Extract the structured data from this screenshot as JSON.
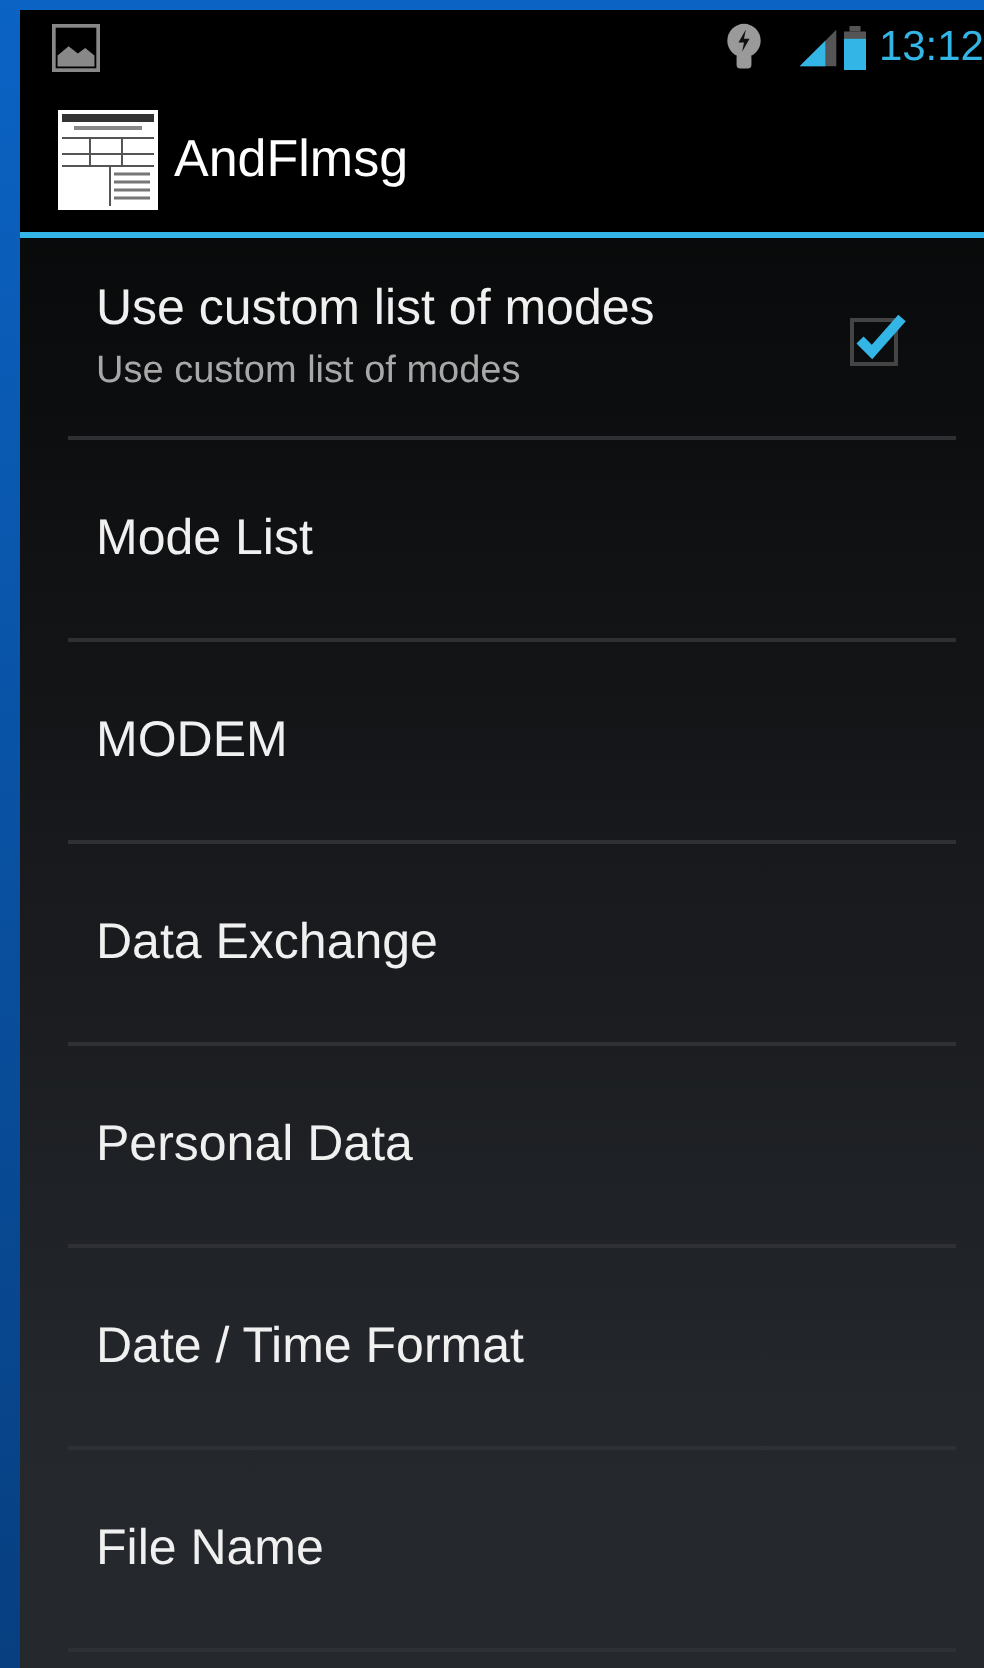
{
  "status_bar": {
    "time": "13:12"
  },
  "action_bar": {
    "title": "AndFlmsg"
  },
  "preferences": [
    {
      "kind": "checkbox",
      "title": "Use custom list of modes",
      "summary": "Use custom list of modes",
      "checked": true
    },
    {
      "kind": "plain",
      "title": "Mode List"
    },
    {
      "kind": "plain",
      "title": "MODEM"
    },
    {
      "kind": "plain",
      "title": "Data Exchange"
    },
    {
      "kind": "plain",
      "title": "Personal Data"
    },
    {
      "kind": "plain",
      "title": "Date / Time Format"
    },
    {
      "kind": "plain",
      "title": "File Name"
    }
  ]
}
